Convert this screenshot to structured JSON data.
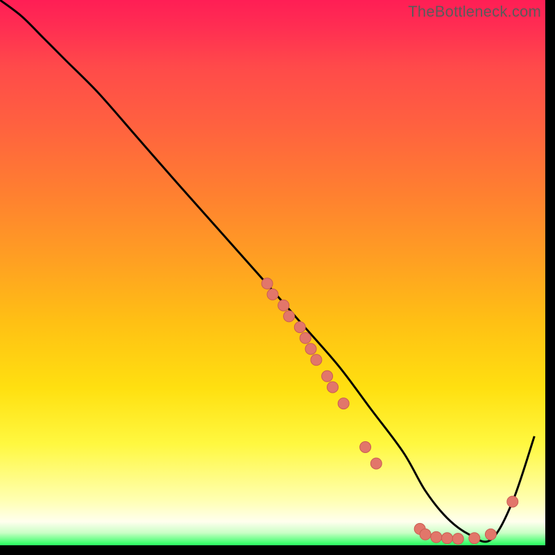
{
  "watermark": "TheBottleneck.com",
  "colors": {
    "curve_stroke": "#000000",
    "dot_fill": "#e2766a",
    "dot_stroke": "#c95d52"
  },
  "chart_data": {
    "type": "line",
    "title": "",
    "xlabel": "",
    "ylabel": "",
    "xlim": [
      0,
      100
    ],
    "ylim": [
      0,
      100
    ],
    "series": [
      {
        "name": "curve",
        "x": [
          0,
          4,
          8,
          12,
          18,
          25,
          32,
          40,
          48,
          55,
          62,
          68,
          74,
          78,
          82,
          86,
          90,
          94,
          98
        ],
        "y": [
          100,
          97,
          93,
          89,
          83,
          75,
          67,
          58,
          49,
          41,
          33,
          25,
          17,
          10,
          5,
          2,
          1,
          8,
          20
        ]
      }
    ],
    "dots": [
      {
        "x": 49,
        "y": 48
      },
      {
        "x": 50,
        "y": 46
      },
      {
        "x": 52,
        "y": 44
      },
      {
        "x": 53,
        "y": 42
      },
      {
        "x": 55,
        "y": 40
      },
      {
        "x": 56,
        "y": 38
      },
      {
        "x": 57,
        "y": 36
      },
      {
        "x": 58,
        "y": 34
      },
      {
        "x": 60,
        "y": 31
      },
      {
        "x": 61,
        "y": 29
      },
      {
        "x": 63,
        "y": 26
      },
      {
        "x": 67,
        "y": 18
      },
      {
        "x": 69,
        "y": 15
      },
      {
        "x": 77,
        "y": 3
      },
      {
        "x": 78,
        "y": 2
      },
      {
        "x": 80,
        "y": 1.5
      },
      {
        "x": 82,
        "y": 1.3
      },
      {
        "x": 84,
        "y": 1.2
      },
      {
        "x": 87,
        "y": 1.3
      },
      {
        "x": 90,
        "y": 2
      },
      {
        "x": 94,
        "y": 8
      }
    ]
  }
}
